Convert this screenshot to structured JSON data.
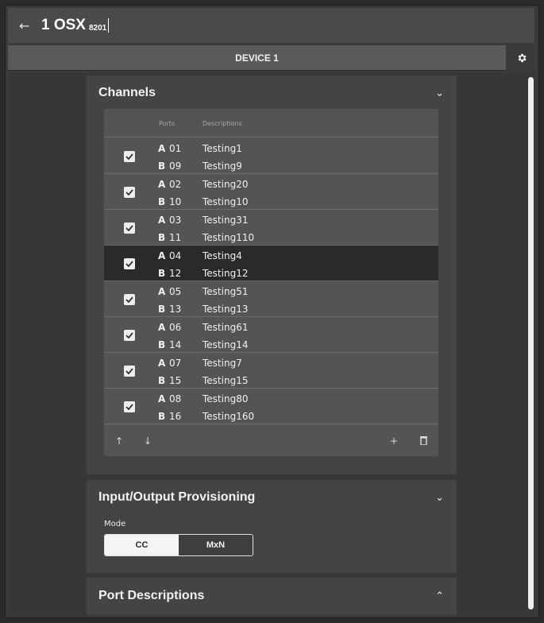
{
  "header": {
    "title": "1 OSX",
    "subtitle": "8201"
  },
  "device_tab": {
    "label": "DEVICE 1"
  },
  "channels": {
    "title": "Channels",
    "col_ports": "Ports",
    "col_descriptions": "Descriptions",
    "rows": [
      {
        "a_side": "A",
        "a_port": "01",
        "a_desc": "Testing1",
        "b_side": "B",
        "b_port": "09",
        "b_desc": "Testing9",
        "checked": true,
        "selected": false
      },
      {
        "a_side": "A",
        "a_port": "02",
        "a_desc": "Testing20",
        "b_side": "B",
        "b_port": "10",
        "b_desc": "Testing10",
        "checked": true,
        "selected": false
      },
      {
        "a_side": "A",
        "a_port": "03",
        "a_desc": "Testing31",
        "b_side": "B",
        "b_port": "11",
        "b_desc": "Testing110",
        "checked": true,
        "selected": false
      },
      {
        "a_side": "A",
        "a_port": "04",
        "a_desc": "Testing4",
        "b_side": "B",
        "b_port": "12",
        "b_desc": "Testing12",
        "checked": true,
        "selected": true
      },
      {
        "a_side": "A",
        "a_port": "05",
        "a_desc": "Testing51",
        "b_side": "B",
        "b_port": "13",
        "b_desc": "Testing13",
        "checked": true,
        "selected": false
      },
      {
        "a_side": "A",
        "a_port": "06",
        "a_desc": "Testing61",
        "b_side": "B",
        "b_port": "14",
        "b_desc": "Testing14",
        "checked": true,
        "selected": false
      },
      {
        "a_side": "A",
        "a_port": "07",
        "a_desc": "Testing7",
        "b_side": "B",
        "b_port": "15",
        "b_desc": "Testing15",
        "checked": true,
        "selected": false
      },
      {
        "a_side": "A",
        "a_port": "08",
        "a_desc": "Testing80",
        "b_side": "B",
        "b_port": "16",
        "b_desc": "Testing160",
        "checked": true,
        "selected": false
      }
    ],
    "footer_icons": [
      "arrow-up-icon",
      "arrow-down-icon",
      "plus-icon",
      "trash-icon"
    ]
  },
  "provisioning": {
    "title": "Input/Output Provisioning",
    "mode_label": "Mode",
    "options": [
      "CC",
      "MxN"
    ],
    "selected": "CC"
  },
  "port_descriptions": {
    "title": "Port Descriptions"
  },
  "colors": {
    "selected_row": "#2a2a2a",
    "panel": "#444444",
    "table": "#545454"
  }
}
